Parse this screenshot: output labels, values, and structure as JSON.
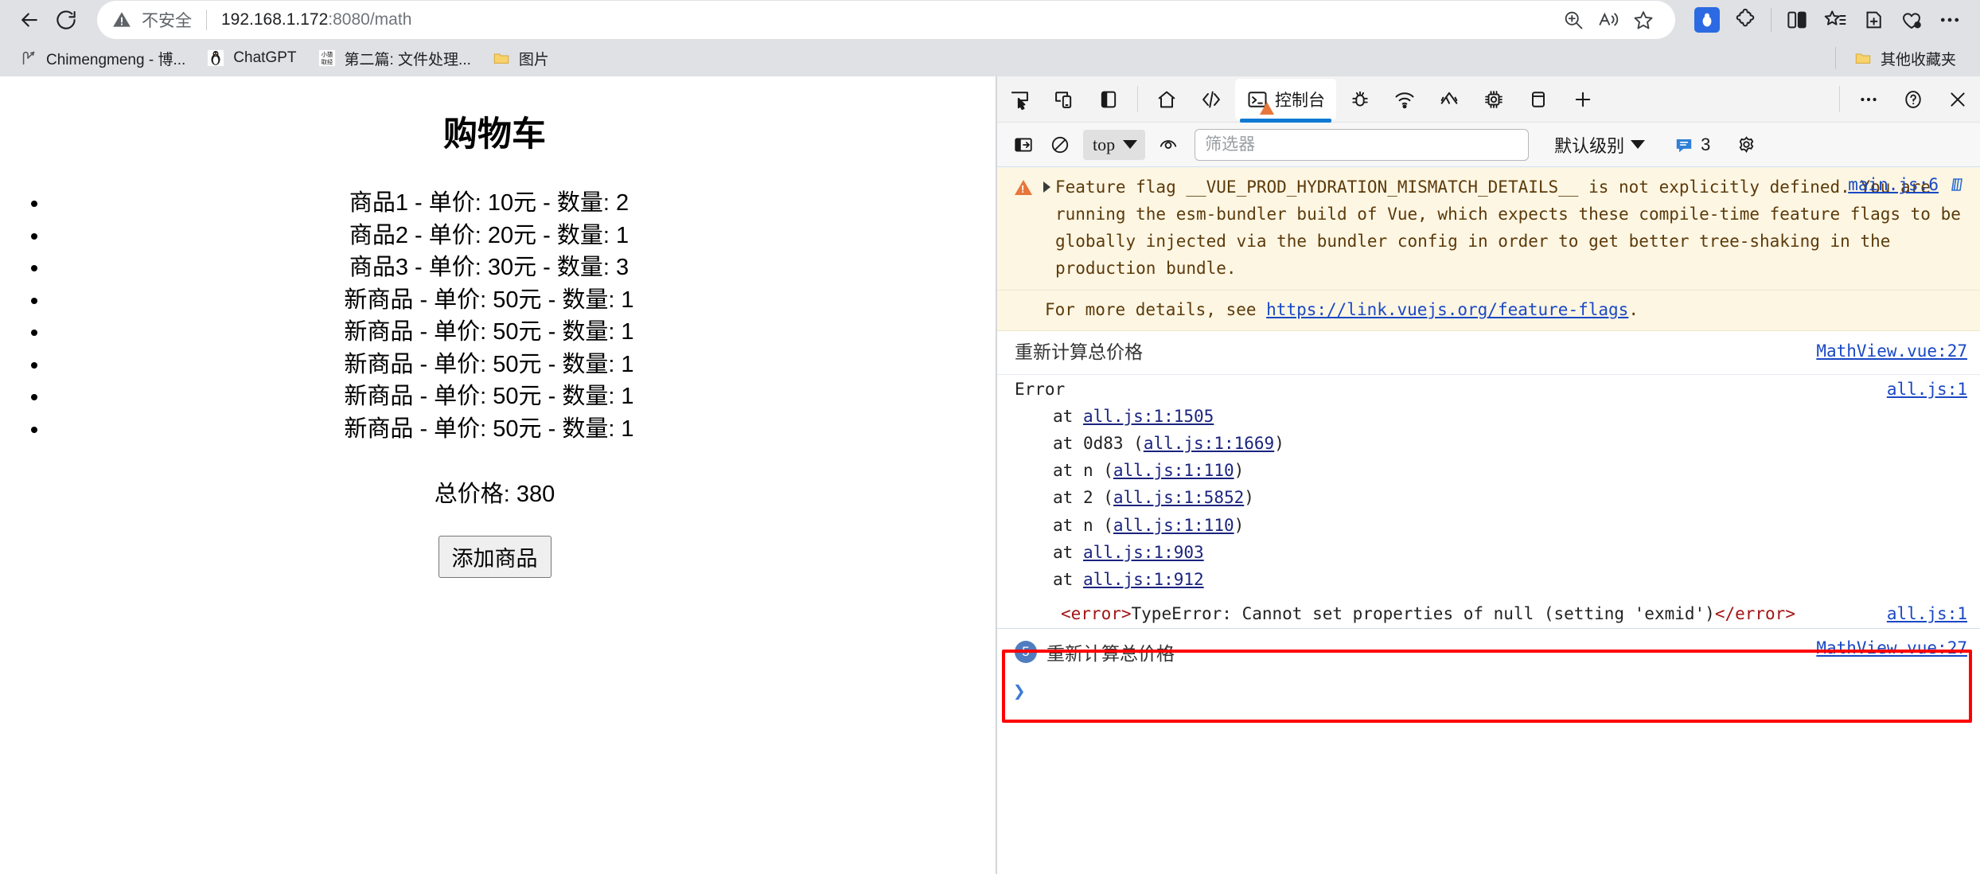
{
  "browser": {
    "nav": {
      "back_label": "后退",
      "refresh_label": "刷新"
    },
    "omnibox": {
      "security_label": "不安全",
      "url_host": "192.168.1.172",
      "url_rest": ":8080/math",
      "full_url": "192.168.1.172:8080/math"
    },
    "bookmarks": [
      {
        "label": "Chimengmeng - 博...",
        "icon": "blog-icon"
      },
      {
        "label": "ChatGPT",
        "icon": "penguin-icon"
      },
      {
        "label": "第二篇: 文件处理...",
        "icon": "monkey-icon"
      },
      {
        "label": "图片",
        "icon": "folder-icon"
      }
    ],
    "bookmarks_other": {
      "label": "其他收藏夹",
      "icon": "folder-icon"
    }
  },
  "page": {
    "title": "购物车",
    "items": [
      "商品1 - 单价: 10元 - 数量: 2",
      "商品2 - 单价: 20元 - 数量: 1",
      "商品3 - 单价: 30元 - 数量: 3",
      "新商品 - 单价: 50元 - 数量: 1",
      "新商品 - 单价: 50元 - 数量: 1",
      "新商品 - 单价: 50元 - 数量: 1",
      "新商品 - 单价: 50元 - 数量: 1",
      "新商品 - 单价: 50元 - 数量: 1"
    ],
    "total_label": "总价格: 380",
    "add_button": "添加商品"
  },
  "devtools": {
    "tabs": [
      {
        "label": "控制台",
        "icon": "console-icon",
        "active": true,
        "badge": "warning"
      }
    ],
    "console": {
      "context_value": "top",
      "filter_placeholder": "筛选器",
      "filter_value": "",
      "level_label": "默认级别",
      "issues_count": "3",
      "messages": [
        {
          "type": "warning",
          "text_part1": "Feature flag __VUE_PROD_HYDRATION_MISMATCH_DETAILS__ is not explicitly defined. You are running the esm-bundler build of Vue, which expects these compile-time feature flags to be globally injected via the bundler config in order to get better tree-shaking in the production bundle.",
          "source": "main.js:6",
          "more_prefix": "For more details, see ",
          "more_link": "https://link.vuejs.org/feature-flags",
          "more_suffix": "."
        },
        {
          "type": "log",
          "text": "重新计算总价格",
          "source": "MathView.vue:27"
        },
        {
          "type": "error",
          "title": "Error",
          "source": "all.js:1",
          "stack": [
            {
              "prefix": "at ",
              "name": "",
              "link": "all.js:1:1505",
              "paren": false
            },
            {
              "prefix": "at ",
              "name": "0d83 ",
              "link": "all.js:1:1669",
              "paren": true
            },
            {
              "prefix": "at ",
              "name": "n ",
              "link": "all.js:1:110",
              "paren": true
            },
            {
              "prefix": "at ",
              "name": "2 ",
              "link": "all.js:1:5852",
              "paren": true
            },
            {
              "prefix": "at ",
              "name": "n ",
              "link": "all.js:1:110",
              "paren": true
            },
            {
              "prefix": "at ",
              "name": "",
              "link": "all.js:1:903",
              "paren": false
            },
            {
              "prefix": "at ",
              "name": "",
              "link": "all.js:1:912",
              "paren": false
            }
          ]
        },
        {
          "type": "xml",
          "open_tag": "<error>",
          "body": "TypeError: Cannot set properties of null (setting 'exmid')",
          "close_tag": "</error>",
          "source": "all.js:1"
        },
        {
          "type": "grouped",
          "count": "5",
          "text": "重新计算总价格",
          "source": "MathView.vue:27",
          "highlighted": true
        }
      ],
      "prompt": "❯"
    }
  },
  "colors": {
    "accent_blue": "#0f7ad4",
    "warning_bg": "#fdf6e3",
    "warning_orange": "#e8763a",
    "link_blue": "#1a48c4",
    "highlight_red": "#ff0000",
    "chrome_bg": "#dfe1e5"
  }
}
